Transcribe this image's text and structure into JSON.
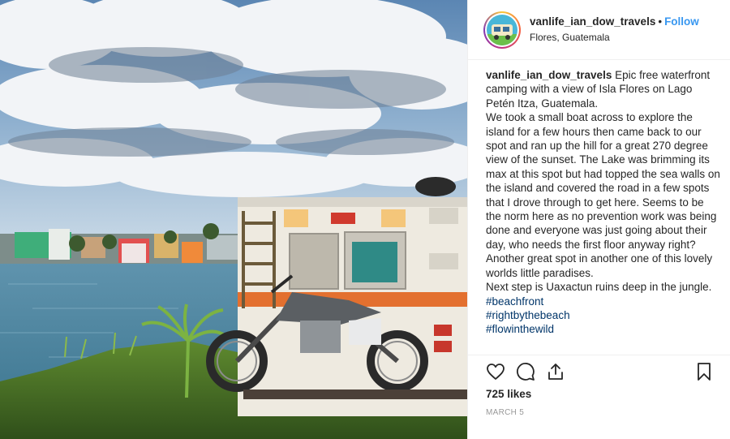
{
  "post": {
    "username": "vanlife_ian_dow_travels",
    "separator": "•",
    "follow_label": "Follow",
    "location": "Flores, Guatemala",
    "caption_user": "vanlife_ian_dow_travels",
    "caption_paragraphs": [
      "Epic free waterfront camping with a view of Isla Flores on Lago Petén Itza, Guatemala.",
      "We took a small boat across to explore the island for a few hours then came back to our spot and ran up the hill for a great 270 degree view of the sunset. The Lake was brimming its max at this spot but had topped the sea walls on the island and covered the road in a few spots that I drove through to get here. Seems to be the norm here as no prevention work was being done and everyone was just going about their day, who needs the first floor anyway right? Another great spot in another one of this lovely worlds little paradises.",
      "Next step is Uaxactun ruins deep in the jungle."
    ],
    "hashtags": [
      "#beachfront",
      "#rightbythebeach",
      "#flowinthewild"
    ],
    "likes": "725 likes",
    "date": "MARCH 5"
  },
  "icons": {
    "like": "heart-icon",
    "comment": "comment-icon",
    "share": "share-icon",
    "save": "bookmark-icon"
  },
  "colors": {
    "follow": "#3897f0",
    "hashtag": "#003569",
    "text": "#262626",
    "muted": "#999999"
  }
}
